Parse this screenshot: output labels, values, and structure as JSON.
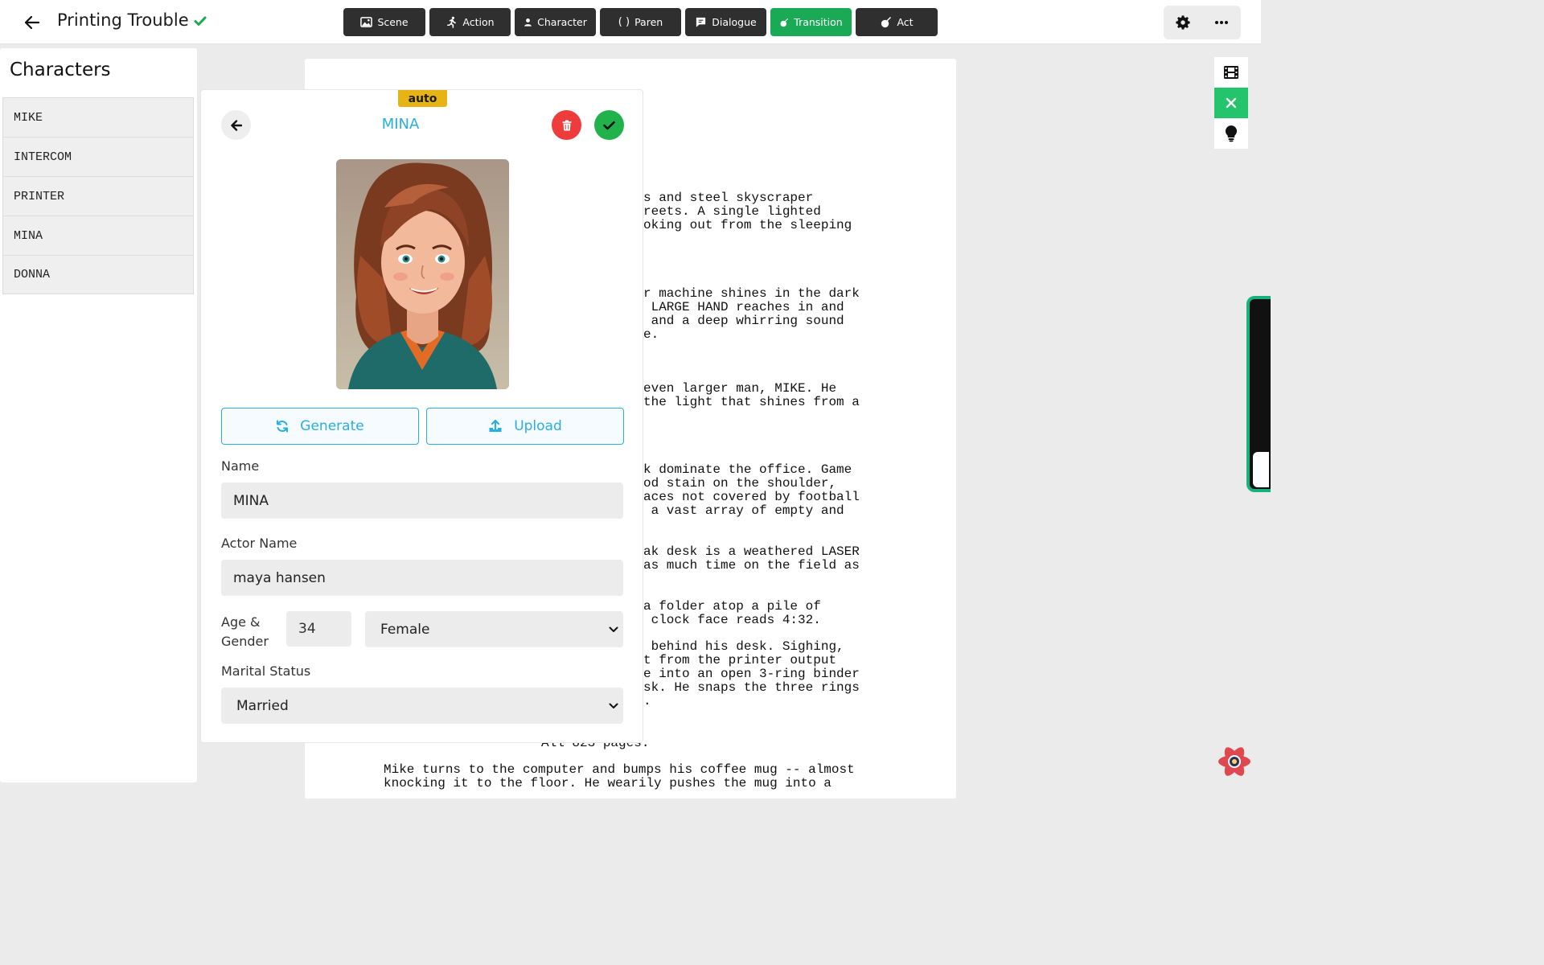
{
  "header": {
    "title": "Printing Trouble",
    "tools": [
      {
        "label": "Scene",
        "icon": "image-icon"
      },
      {
        "label": "Action",
        "icon": "running-icon"
      },
      {
        "label": "Character",
        "icon": "person-icon"
      },
      {
        "label": "Paren",
        "icon": "parentheses-icon",
        "glyph": "( )"
      },
      {
        "label": "Dialogue",
        "icon": "speech-bubble-icon"
      },
      {
        "label": "Transition",
        "icon": "bomb-icon",
        "active": true
      },
      {
        "label": "Act",
        "icon": "bomb-icon"
      }
    ],
    "accent_active": "#1aaa55"
  },
  "sidebar": {
    "title": "Characters",
    "items": [
      "MIKE",
      "INTERCOM",
      "PRINTER",
      "MINA",
      "DONNA"
    ]
  },
  "script": {
    "lines": [
      "s and steel skyscraper",
      "reets. A single lighted",
      "oking out from the sleeping",
      "r machine shines in the dark",
      " LARGE HAND reaches in and",
      " and a deep whirring sound",
      "e.",
      "even larger man, MIKE. He",
      "the light that shines from a",
      "k dominate the office. Game",
      "od stain on the shoulder,",
      "aces not covered by football",
      " a vast array of empty and",
      "ak desk is a weathered LASER",
      "as much time on the field as",
      "a folder atop a pile of",
      " clock face reads 4:32.",
      " behind his desk. Sighing,",
      "t from the printer output",
      "e into an open 3-ring binder",
      "sk. He snaps the three rings",
      ".",
      "All 823 pages.",
      "Mike turns to the computer and bumps his coffee mug -- almost",
      "knocking it to the floor. He wearily pushes the mug into a"
    ]
  },
  "editor": {
    "badge": "auto",
    "character_name": "MINA",
    "generate_label": "Generate",
    "upload_label": "Upload",
    "name_label": "Name",
    "name_value": "MINA",
    "actor_label": "Actor Name",
    "actor_value": "maya hansen",
    "age_gender_label": "Age & Gender",
    "age_value": "34",
    "gender_value": "Female",
    "marital_label": "Marital Status",
    "marital_value": "Married"
  }
}
